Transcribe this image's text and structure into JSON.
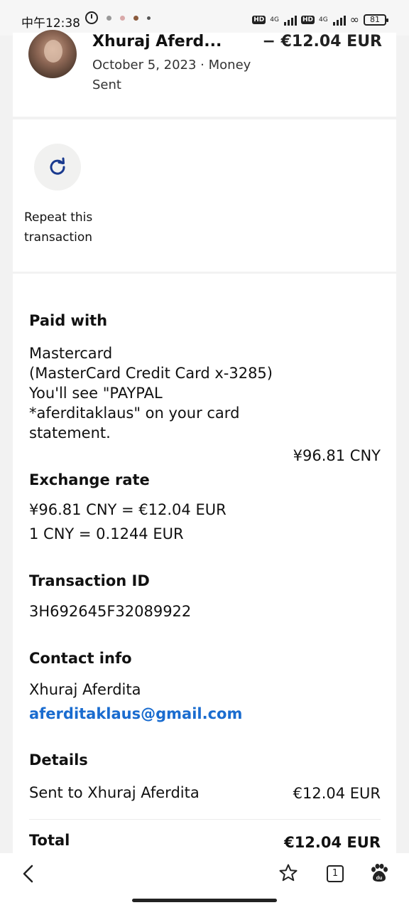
{
  "status_bar": {
    "time": "中午12:38",
    "net_label_1": "4G",
    "net_label_2": "4G",
    "hd_label_1": "HD",
    "hd_label_2": "HD",
    "battery": "81"
  },
  "header": {
    "name": "Xhuraj Aferd...",
    "amount": "− €12.04 EUR",
    "date_type": "October 5, 2023 · Money Sent"
  },
  "repeat": {
    "label": "Repeat this transaction",
    "icon": "refresh-icon",
    "accent": "#1a3a8f"
  },
  "paid_with": {
    "title": "Paid with",
    "method": "Mastercard",
    "card": "(MasterCard Credit Card x-3285)",
    "statement_note": "You'll see \"PAYPAL *aferditaklaus\" on your card statement.",
    "amount": "¥96.81 CNY"
  },
  "exchange": {
    "title": "Exchange rate",
    "line1": "¥96.81 CNY = €12.04 EUR",
    "line2": "1 CNY = 0.1244 EUR"
  },
  "transaction": {
    "title": "Transaction ID",
    "id": "3H692645F32089922"
  },
  "contact": {
    "title": "Contact info",
    "name": "Xhuraj Aferdita",
    "email": "aferditaklaus@gmail.com",
    "link_color": "#1a6ccf"
  },
  "details": {
    "title": "Details",
    "row_label": "Sent to Xhuraj Aferdita",
    "row_value": "€12.04 EUR"
  },
  "total": {
    "label": "Total",
    "value": "€12.04 EUR"
  },
  "bottom_nav": {
    "back_icon": "back-arrow-icon",
    "star_icon": "star-icon",
    "tab_count": "1",
    "baidu_icon": "baidu-paw-icon"
  }
}
